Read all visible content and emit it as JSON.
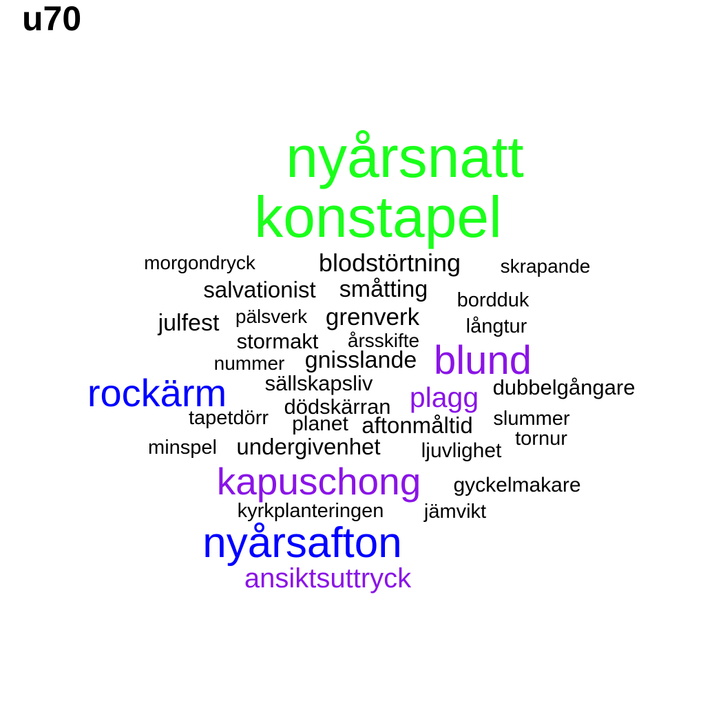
{
  "title": "u70",
  "colors": {
    "green": "#1aff1a",
    "purple": "#8a14e6",
    "blue": "#0000ff",
    "black": "#000000"
  },
  "words": [
    {
      "text": "nyårsnatt",
      "color": "green"
    },
    {
      "text": "konstapel",
      "color": "green"
    },
    {
      "text": "morgondryck",
      "color": "black"
    },
    {
      "text": "blodstörtning",
      "color": "black"
    },
    {
      "text": "skrapande",
      "color": "black"
    },
    {
      "text": "salvationist",
      "color": "black"
    },
    {
      "text": "småtting",
      "color": "black"
    },
    {
      "text": "bordduk",
      "color": "black"
    },
    {
      "text": "julfest",
      "color": "black"
    },
    {
      "text": "pälsverk",
      "color": "black"
    },
    {
      "text": "grenverk",
      "color": "black"
    },
    {
      "text": "långtur",
      "color": "black"
    },
    {
      "text": "stormakt",
      "color": "black"
    },
    {
      "text": "årsskifte",
      "color": "black"
    },
    {
      "text": "nummer",
      "color": "black"
    },
    {
      "text": "gnisslande",
      "color": "black"
    },
    {
      "text": "blund",
      "color": "purple"
    },
    {
      "text": "rockärm",
      "color": "blue"
    },
    {
      "text": "sällskapsliv",
      "color": "black"
    },
    {
      "text": "plagg",
      "color": "purple"
    },
    {
      "text": "dubbelgångare",
      "color": "black"
    },
    {
      "text": "dödskärran",
      "color": "black"
    },
    {
      "text": "tapetdörr",
      "color": "black"
    },
    {
      "text": "planet",
      "color": "black"
    },
    {
      "text": "aftonmåltid",
      "color": "black"
    },
    {
      "text": "slummer",
      "color": "black"
    },
    {
      "text": "tornur",
      "color": "black"
    },
    {
      "text": "minspel",
      "color": "black"
    },
    {
      "text": "undergivenhet",
      "color": "black"
    },
    {
      "text": "ljuvlighet",
      "color": "black"
    },
    {
      "text": "kapuschong",
      "color": "purple"
    },
    {
      "text": "gyckelmakare",
      "color": "black"
    },
    {
      "text": "kyrkplanteringen",
      "color": "black"
    },
    {
      "text": "jämvikt",
      "color": "black"
    },
    {
      "text": "nyårsafton",
      "color": "blue"
    },
    {
      "text": "ansiktsuttryck",
      "color": "purple"
    }
  ]
}
